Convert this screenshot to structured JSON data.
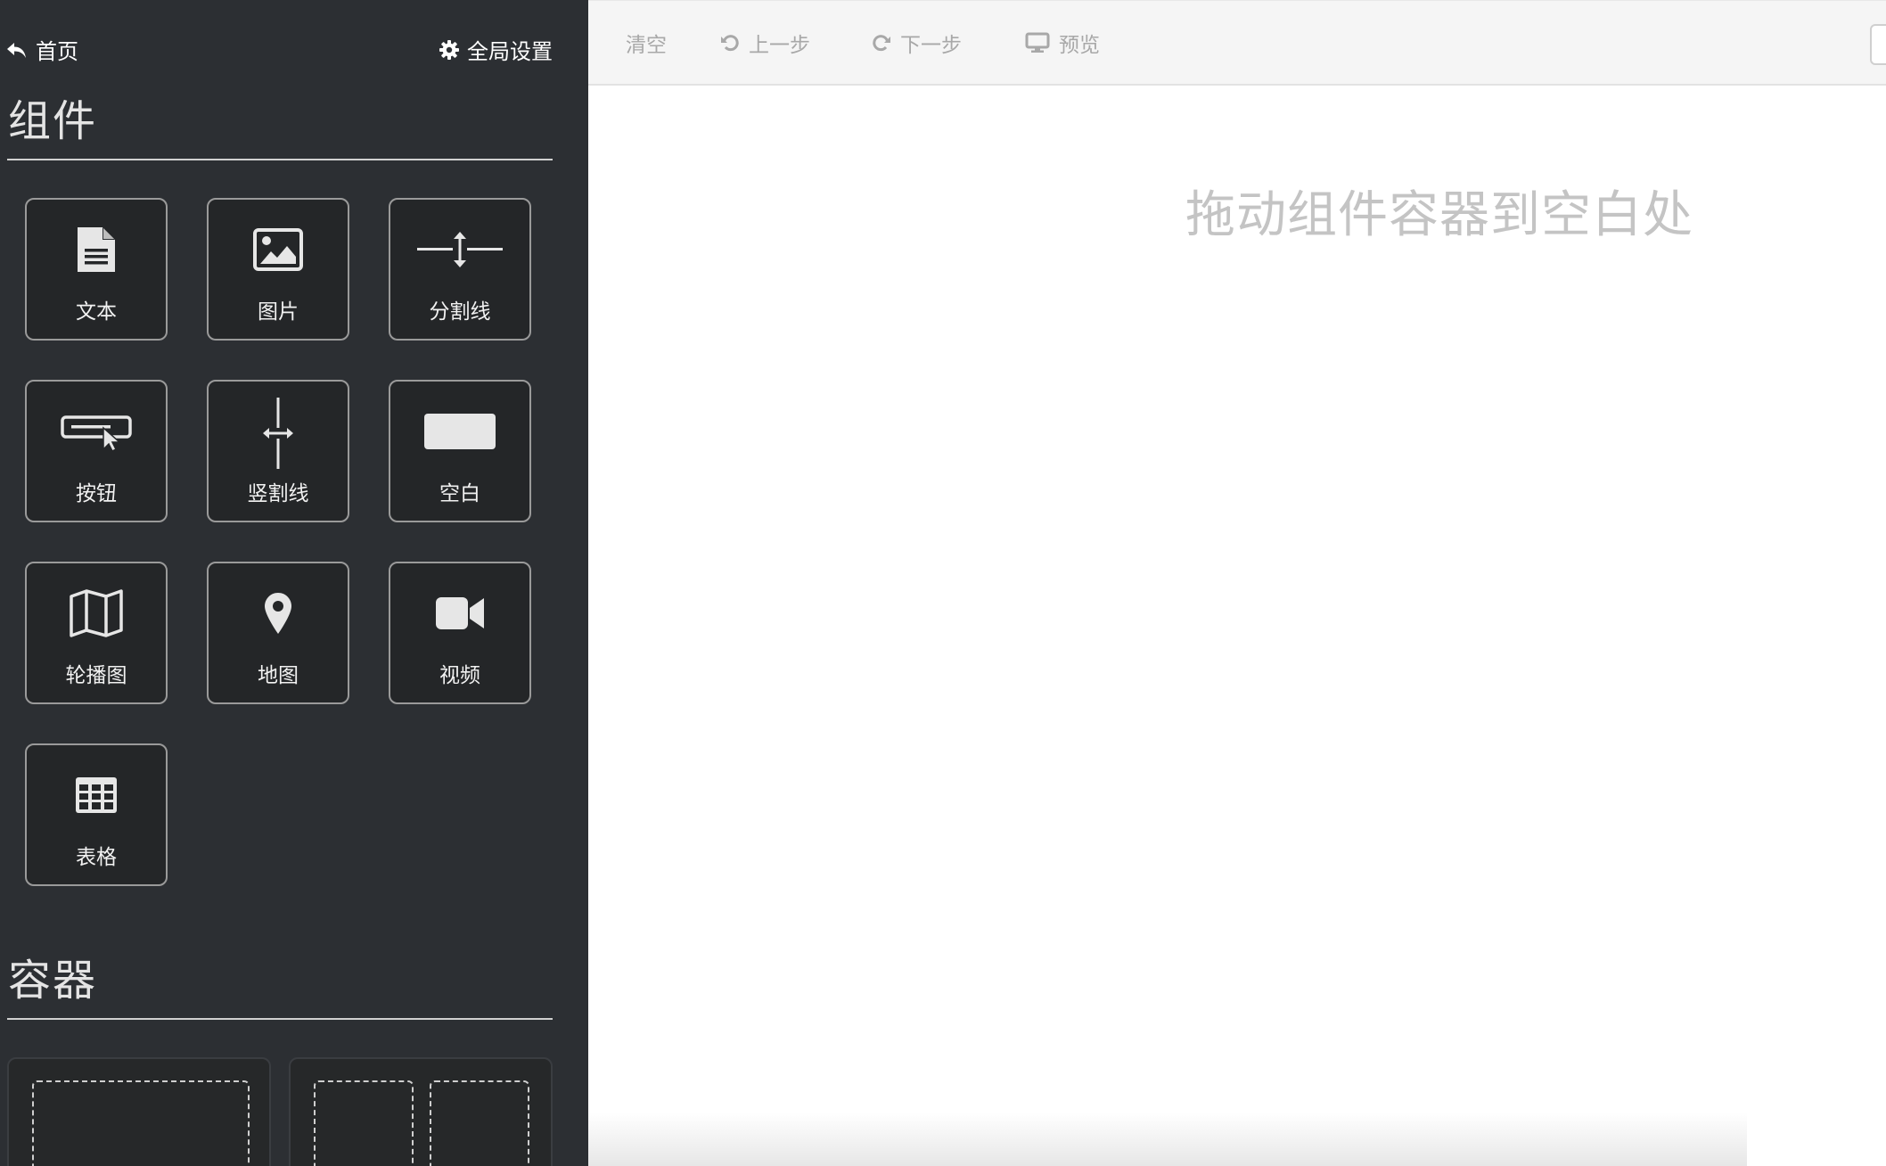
{
  "sidebar": {
    "home_label": "首页",
    "settings_label": "全局设置",
    "components_title": "组件",
    "containers_title": "容器",
    "components": [
      {
        "label": "文本",
        "icon": "file-text-icon"
      },
      {
        "label": "图片",
        "icon": "image-icon"
      },
      {
        "label": "分割线",
        "icon": "divider-icon"
      },
      {
        "label": "按钮",
        "icon": "button-icon"
      },
      {
        "label": "竖割线",
        "icon": "vertical-divider-icon"
      },
      {
        "label": "空白",
        "icon": "blank-icon"
      },
      {
        "label": "轮播图",
        "icon": "carousel-icon"
      },
      {
        "label": "地图",
        "icon": "map-marker-icon"
      },
      {
        "label": "视频",
        "icon": "video-icon"
      },
      {
        "label": "表格",
        "icon": "table-icon"
      }
    ]
  },
  "toolbar": {
    "clear_label": "清空",
    "undo_label": "上一步",
    "redo_label": "下一步",
    "preview_label": "预览"
  },
  "canvas": {
    "placeholder": "拖动组件容器到空白处"
  },
  "colors": {
    "sidebar_bg": "#2c2f33",
    "tile_border": "#9a9a9a",
    "toolbar_bg": "#f5f5f5",
    "muted_text": "#a8a8a8",
    "placeholder_text": "#c4c4c4"
  }
}
